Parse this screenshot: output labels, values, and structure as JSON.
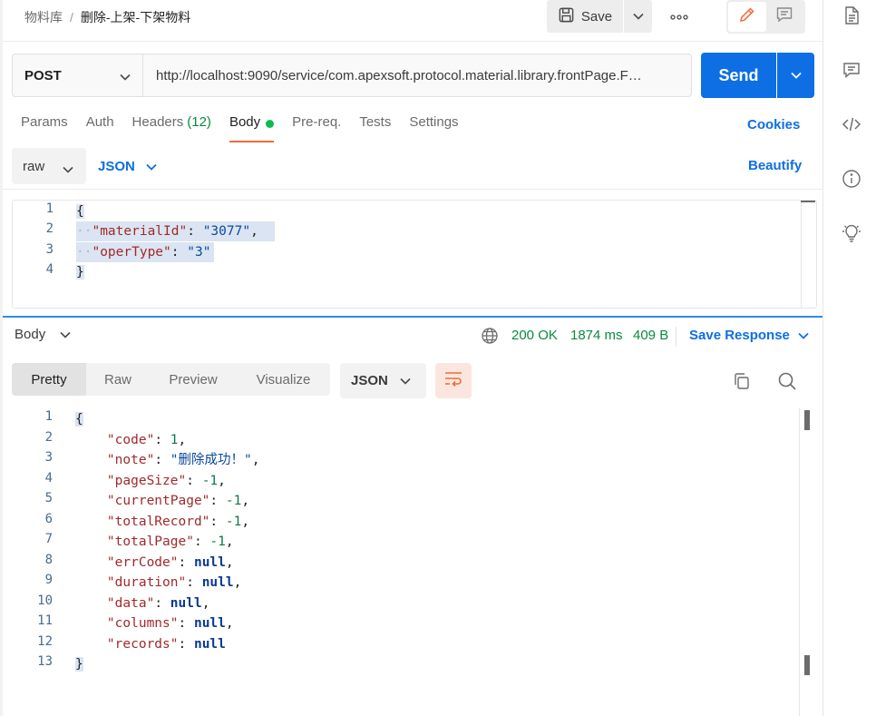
{
  "breadcrumb": {
    "parent": "物料库",
    "separator": "/",
    "current": "删除-上架-下架物料"
  },
  "toolbar": {
    "save_label": "Save"
  },
  "request": {
    "method": "POST",
    "url": "http://localhost:9090/service/com.apexsoft.protocol.material.library.frontPage.F…",
    "send_label": "Send"
  },
  "request_tabs": [
    {
      "label": "Params"
    },
    {
      "label": "Auth"
    },
    {
      "label": "Headers",
      "count": "(12)"
    },
    {
      "label": "Body"
    },
    {
      "label": "Pre-req."
    },
    {
      "label": "Tests"
    },
    {
      "label": "Settings"
    }
  ],
  "cookies_label": "Cookies",
  "body_options": {
    "mode": "raw",
    "language": "JSON",
    "beautify_label": "Beautify"
  },
  "request_body": {
    "line_numbers": [
      "1",
      "2",
      "3",
      "4"
    ],
    "open": "{",
    "close": "}",
    "k1": "\"materialId\"",
    "v1": "\"3077\"",
    "k2": "\"operType\"",
    "v2": "\"3\""
  },
  "response": {
    "section_label": "Body",
    "status": "200 OK",
    "time": "1874 ms",
    "size": "409 B",
    "save_response_label": "Save Response",
    "view_tabs": [
      "Pretty",
      "Raw",
      "Preview",
      "Visualize"
    ],
    "format": "JSON",
    "line_numbers": [
      "1",
      "2",
      "3",
      "4",
      "5",
      "6",
      "7",
      "8",
      "9",
      "10",
      "11",
      "12",
      "13"
    ],
    "open": "{",
    "close": "}",
    "fields": [
      {
        "key": "\"code\"",
        "value": "1",
        "type": "num",
        "comma": ","
      },
      {
        "key": "\"note\"",
        "value": "\"删除成功！\"",
        "type": "str",
        "comma": ","
      },
      {
        "key": "\"pageSize\"",
        "value": "-1",
        "type": "num",
        "comma": ","
      },
      {
        "key": "\"currentPage\"",
        "value": "-1",
        "type": "num",
        "comma": ","
      },
      {
        "key": "\"totalRecord\"",
        "value": "-1",
        "type": "num",
        "comma": ","
      },
      {
        "key": "\"totalPage\"",
        "value": "-1",
        "type": "num",
        "comma": ","
      },
      {
        "key": "\"errCode\"",
        "value": "null",
        "type": "null",
        "comma": ","
      },
      {
        "key": "\"duration\"",
        "value": "null",
        "type": "null",
        "comma": ","
      },
      {
        "key": "\"data\"",
        "value": "null",
        "type": "null",
        "comma": ","
      },
      {
        "key": "\"columns\"",
        "value": "null",
        "type": "null",
        "comma": ","
      },
      {
        "key": "\"records\"",
        "value": "null",
        "type": "null",
        "comma": ""
      }
    ]
  },
  "icons": {
    "rail": [
      "document-icon",
      "comment-icon",
      "code-icon",
      "info-icon",
      "lightbulb-icon"
    ]
  }
}
